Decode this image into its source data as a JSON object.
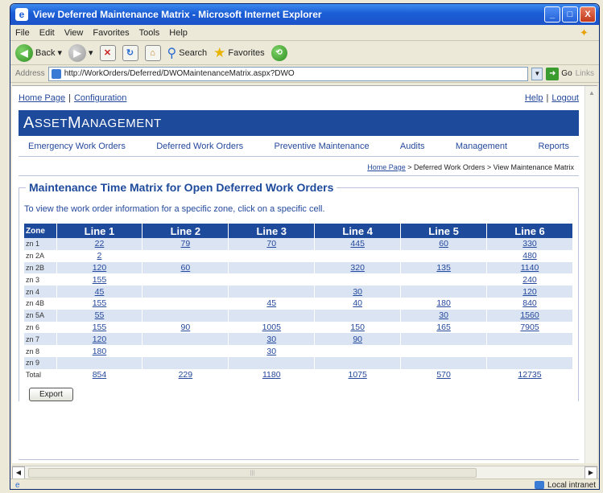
{
  "window": {
    "title": "View Deferred Maintenance Matrix - Microsoft Internet Explorer",
    "buttons": [
      "_",
      "□",
      "X"
    ]
  },
  "menu": [
    "File",
    "Edit",
    "View",
    "Favorites",
    "Tools",
    "Help"
  ],
  "toolbar": {
    "back": "Back",
    "search": "Search",
    "favorites": "Favorites"
  },
  "address": {
    "label": "Address",
    "url": "http://WorkOrders/Deferred/DWOMaintenanceMatrix.aspx?DWO",
    "go": "Go",
    "links": "Links"
  },
  "page": {
    "home": "Home Page",
    "configuration": "Configuration",
    "help": "Help",
    "logout": "Logout",
    "banner_a": "A",
    "banner_b": "SSET ",
    "banner_c": "M",
    "banner_d": "ANAGEMENT",
    "nav": [
      "Emergency Work Orders",
      "Deferred Work Orders",
      "Preventive Maintenance",
      "Audits",
      "Management",
      "Reports"
    ],
    "breadcrumb": {
      "home": "Home Page",
      "rest": " > Deferred Work Orders > View Maintenance Matrix"
    },
    "panel_title": "Maintenance Time Matrix for Open Deferred Work Orders",
    "instructions": "To view the work order information for a specific zone, click on a specific cell.",
    "export": "Export"
  },
  "matrix": {
    "headers": [
      "Zone",
      "Line 1",
      "Line 2",
      "Line 3",
      "Line 4",
      "Line 5",
      "Line 6"
    ],
    "rows": [
      [
        "zn 1",
        "22",
        "79",
        "70",
        "445",
        "60",
        "330"
      ],
      [
        "zn 2A",
        "2",
        "",
        "",
        "",
        "",
        "480"
      ],
      [
        "zn 2B",
        "120",
        "60",
        "",
        "320",
        "135",
        "1140"
      ],
      [
        "zn 3",
        "155",
        "",
        "",
        "",
        "",
        "240"
      ],
      [
        "zn 4",
        "45",
        "",
        "",
        "30",
        "",
        "120"
      ],
      [
        "zn 4B",
        "155",
        "",
        "45",
        "40",
        "180",
        "840"
      ],
      [
        "zn 5A",
        "55",
        "",
        "",
        "",
        "30",
        "1560"
      ],
      [
        "zn 6",
        "155",
        "90",
        "1005",
        "150",
        "165",
        "7905"
      ],
      [
        "zn 7",
        "120",
        "",
        "30",
        "90",
        "",
        ""
      ],
      [
        "zn 8",
        "180",
        "",
        "30",
        "",
        "",
        ""
      ],
      [
        "zn 9",
        "",
        "",
        "",
        "",
        "",
        ""
      ],
      [
        "Total",
        "854",
        "229",
        "1180",
        "1075",
        "570",
        "12735"
      ]
    ]
  },
  "status": {
    "zone": "Local intranet"
  }
}
